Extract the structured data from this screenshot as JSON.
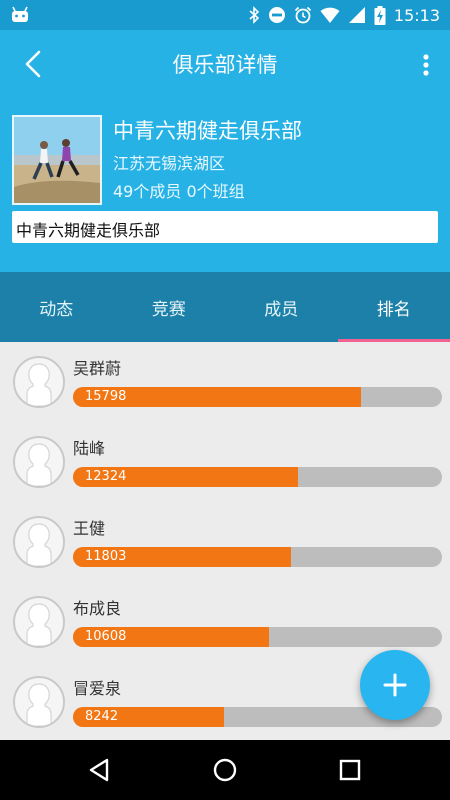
{
  "status_bar": {
    "time": "15:13"
  },
  "toolbar": {
    "title": "俱乐部详情"
  },
  "club": {
    "name": "中青六期健走俱乐部",
    "location": "江苏无锡滨湖区",
    "stats": "49个成员 0个班组",
    "description": "中青六期健走俱乐部"
  },
  "tabs": [
    {
      "label": "动态",
      "active": false
    },
    {
      "label": "竞赛",
      "active": false
    },
    {
      "label": "成员",
      "active": false
    },
    {
      "label": "排名",
      "active": true
    }
  ],
  "ranking": [
    {
      "name": "吴群蔚",
      "score": "15798",
      "fill": 0.78
    },
    {
      "name": "陆峰",
      "score": "12324",
      "fill": 0.61
    },
    {
      "name": "王健",
      "score": "11803",
      "fill": 0.59
    },
    {
      "name": "布成良",
      "score": "10608",
      "fill": 0.53
    },
    {
      "name": "冒爱泉",
      "score": "8242",
      "fill": 0.41
    }
  ],
  "colors": {
    "header": "#27b2e6",
    "status_bar": "#1a9bd0",
    "tab_bar": "#1c80a8",
    "tab_indicator": "#f06292",
    "bar_fill": "#f27613",
    "bar_track": "#bdbdbd",
    "fab": "#29b6f0"
  },
  "icons": {
    "back": "arrow-back-icon",
    "more": "more-vert-icon",
    "fab": "add-icon",
    "nav_back": "triangle-back-icon",
    "nav_home": "circle-home-icon",
    "nav_recent": "square-recent-icon"
  }
}
